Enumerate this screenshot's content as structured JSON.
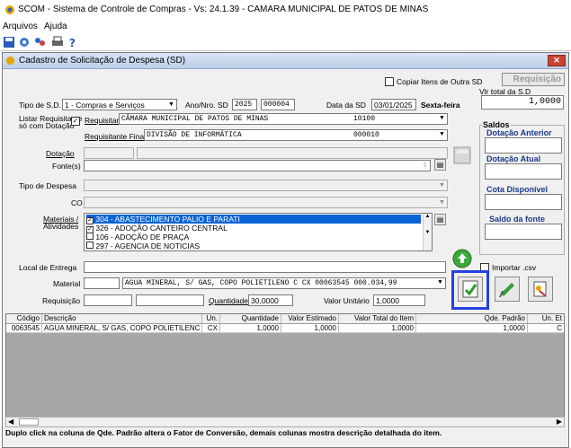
{
  "app": {
    "title": "SCOM - Sistema de Controle de Compras - Vs: 24.1.39 - CAMARA MUNICIPAL DE PATOS DE MINAS"
  },
  "menu": {
    "arquivos": "Arquivos",
    "ajuda": "Ajuda"
  },
  "child_title": "Cadastro de Solicitação de Despesa (SD)",
  "header": {
    "copiar_itens": "Copiar Itens de Outra SD",
    "requisicao_btn": "Requisição",
    "vlr_total_label": "Vlr total da S.D",
    "vlr_total": "1,0000",
    "tipo_sd_label": "Tipo de S.D.",
    "tipo_sd": "1 - Compras e Serviços",
    "ano_label": "Ano/Nro. SD",
    "ano": "2025",
    "nro": "000004",
    "data_label": "Data da SD",
    "data": "03/01/2025",
    "dia": "Sexta-feira"
  },
  "requisitante": {
    "listar_label_1": "Listar Requisitante",
    "listar_label_2": "só com Dotação",
    "check": "✓",
    "req_label": "Requisitante",
    "req_name": "CÂMARA MUNICIPAL DE PATOS DE MINAS",
    "req_code": "10100",
    "final_label": "Requisitante Final",
    "final_name": "DIVISÃO DE INFORMÁTICA",
    "final_code": "000010"
  },
  "fields": {
    "dotacao": "Dotação",
    "fonte": "Fonte(s)",
    "tipo_despesa": "Tipo de Despesa",
    "co": "CO",
    "materiais_1": "Materiais /",
    "materiais_2": "Atividades",
    "local_entrega": "Local de Entrega",
    "material": "Material",
    "material_value": "AGUA MINERAL, S/ GAS, COPO POLIETILENO C CX 00063545 000.034,99",
    "requisicao": "Requisição",
    "quantidade_label": "Quantidade",
    "quantidade": "30,0000",
    "valor_unit_label": "Valor Unitário",
    "valor_unit": "1,0000",
    "importar": "Importar .csv"
  },
  "materiais": [
    {
      "text": "304 - ABASTECIMENTO PALIO E PARATI",
      "checked": "✓"
    },
    {
      "text": "326 - ADOÇÃO CANTEIRO CENTRAL",
      "checked": "✓"
    },
    {
      "text": "106 - ADOÇÃO DE PRAÇA",
      "checked": ""
    },
    {
      "text": "297 - AGENCIA DE NOTICIAS",
      "checked": ""
    }
  ],
  "saldos": {
    "title": "Saldos",
    "dotacao_anterior": "Dotação Anterior",
    "dotacao_atual": "Dotação Atual",
    "cota": "Cota Disponível",
    "saldo_fonte": "Saldo da fonte"
  },
  "grid": {
    "headers": [
      "Código",
      "Descrição",
      "Un.",
      "Quantidade",
      "Valor Estimado",
      "Valor Total do Item",
      "Qde. Padrão",
      "Un. Et"
    ],
    "row": [
      "0063545",
      "AGUA MINERAL, S/ GAS, COPO POLIETILENC",
      "CX",
      "1,0000",
      "1,0000",
      "1,0000",
      "1,0000",
      "C"
    ]
  },
  "status": "Duplo click na coluna de Qde. Padrão altera o Fator de Conversão, demais colunas mostra descrição detalhada do item.",
  "colors": {
    "accent_blue": "#1a3a8a",
    "highlight": "#2440e0",
    "selected": "#0a64d6"
  }
}
